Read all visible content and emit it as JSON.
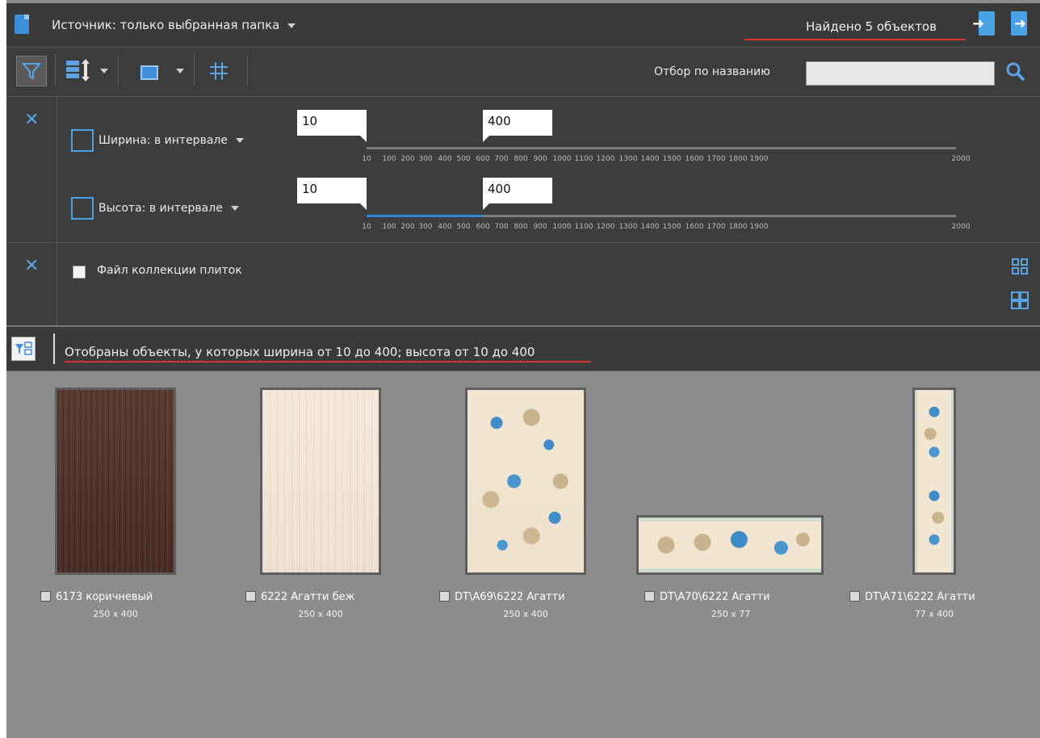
{
  "topbar": {
    "source_label": "Источник: только выбранная папка",
    "found_label": "Найдено 5 объектов"
  },
  "toolbar": {
    "filter_by_name_label": "Отбор по названию",
    "search_value": ""
  },
  "size_filter": {
    "width": {
      "label": "Ширина: в интервале",
      "min": "10",
      "max": "400"
    },
    "height": {
      "label": "Высота: в интервале",
      "min": "10",
      "max": "400"
    },
    "scale_ticks": [
      "10",
      "100",
      "200",
      "300",
      "400",
      "500",
      "600",
      "700",
      "800",
      "900",
      "1000",
      "1100",
      "1200",
      "1300",
      "1400",
      "1500",
      "1600",
      "1700",
      "1800",
      "1900",
      "2000"
    ]
  },
  "collection_filter": {
    "label": "Файл коллекции плиток"
  },
  "status": {
    "text": "Отобраны объекты, у которых ширина от 10 до 400; высота от 10 до 400"
  },
  "gallery": {
    "items": [
      {
        "name": "6173 коричневый",
        "size": "250 x 400"
      },
      {
        "name": "6222 Агатти беж",
        "size": "250 x 400"
      },
      {
        "name": "DT\\A69\\6222 Агатти",
        "size": "250 x 400"
      },
      {
        "name": "DT\\A70\\6222 Агатти",
        "size": "250 x 77"
      },
      {
        "name": "DT\\A71\\6222 Агатти",
        "size": "77 x 400"
      }
    ]
  },
  "colors": {
    "accent": "#2f86dc",
    "panel": "#3d3d3d",
    "underline": "#e0312a",
    "gallery_bg": "#8c8c8c"
  },
  "icons": {
    "source": "document-icon",
    "import": "import-icon",
    "export": "export-icon",
    "filter": "filter-icon",
    "sort": "sort-icon",
    "view": "view-square-icon",
    "grid": "grid-icon",
    "search": "search-icon",
    "remove": "close-icon",
    "width": "width-icon",
    "height": "height-icon"
  }
}
